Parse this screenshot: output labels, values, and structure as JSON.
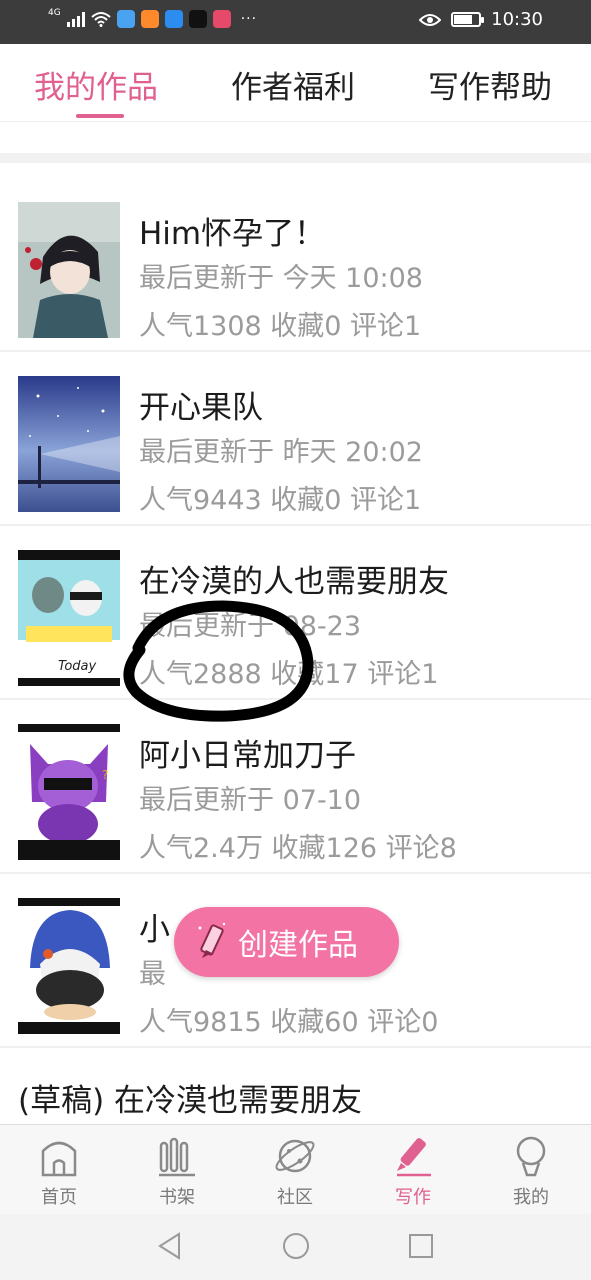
{
  "status_bar": {
    "signal": "4G",
    "time": "10:30",
    "more": "···",
    "icons": [
      "signal-icon",
      "wifi-icon",
      "app-icon",
      "app-icon",
      "app-icon",
      "app-icon",
      "app-icon",
      "eye-icon",
      "battery-icon"
    ],
    "app_icon_colors": [
      "#4aa3f0",
      "#ff8a2b",
      "#2d8cf0",
      "#111111",
      "#e64a6b"
    ]
  },
  "tabs": [
    {
      "label": "我的作品",
      "active": true
    },
    {
      "label": "作者福利",
      "active": false
    },
    {
      "label": "写作帮助",
      "active": false
    }
  ],
  "works": [
    {
      "title": "Him怀孕了！",
      "updated": "最后更新于 今天 10:08",
      "stats": "人气1308 收藏0 评论1"
    },
    {
      "title": "开心果队",
      "updated": "最后更新于 昨天 20:02",
      "stats": "人气9443 收藏0 评论1"
    },
    {
      "title": "在冷漠的人也需要朋友",
      "updated": "最后更新于 08-23",
      "stats": "人气2888 收藏17 评论1"
    },
    {
      "title": "阿小日常加刀子",
      "updated": "最后更新于 07-10",
      "stats": "人气2.4万 收藏126 评论8"
    },
    {
      "title": "小",
      "updated": "最",
      "stats": "人气9815 收藏60 评论0"
    }
  ],
  "cover_texts": {
    "cover3_caption": "Today"
  },
  "draft": {
    "label": "(草稿) 在冷漠也需要朋友"
  },
  "fab": {
    "label": "创建作品",
    "icon": "pencil-icon"
  },
  "bottom_nav": [
    {
      "label": "首页",
      "icon": "home-icon",
      "active": false
    },
    {
      "label": "书架",
      "icon": "bookshelf-icon",
      "active": false
    },
    {
      "label": "社区",
      "icon": "planet-icon",
      "active": false
    },
    {
      "label": "写作",
      "icon": "pencil-icon",
      "active": true
    },
    {
      "label": "我的",
      "icon": "profile-icon",
      "active": false
    }
  ],
  "system_nav": [
    "back-icon",
    "home-circle-icon",
    "recents-icon"
  ],
  "colors": {
    "accent": "#e0608f",
    "fab": "#f273a4",
    "secondary_text": "#9b9b9b",
    "status_bar": "#3c3c3c"
  }
}
